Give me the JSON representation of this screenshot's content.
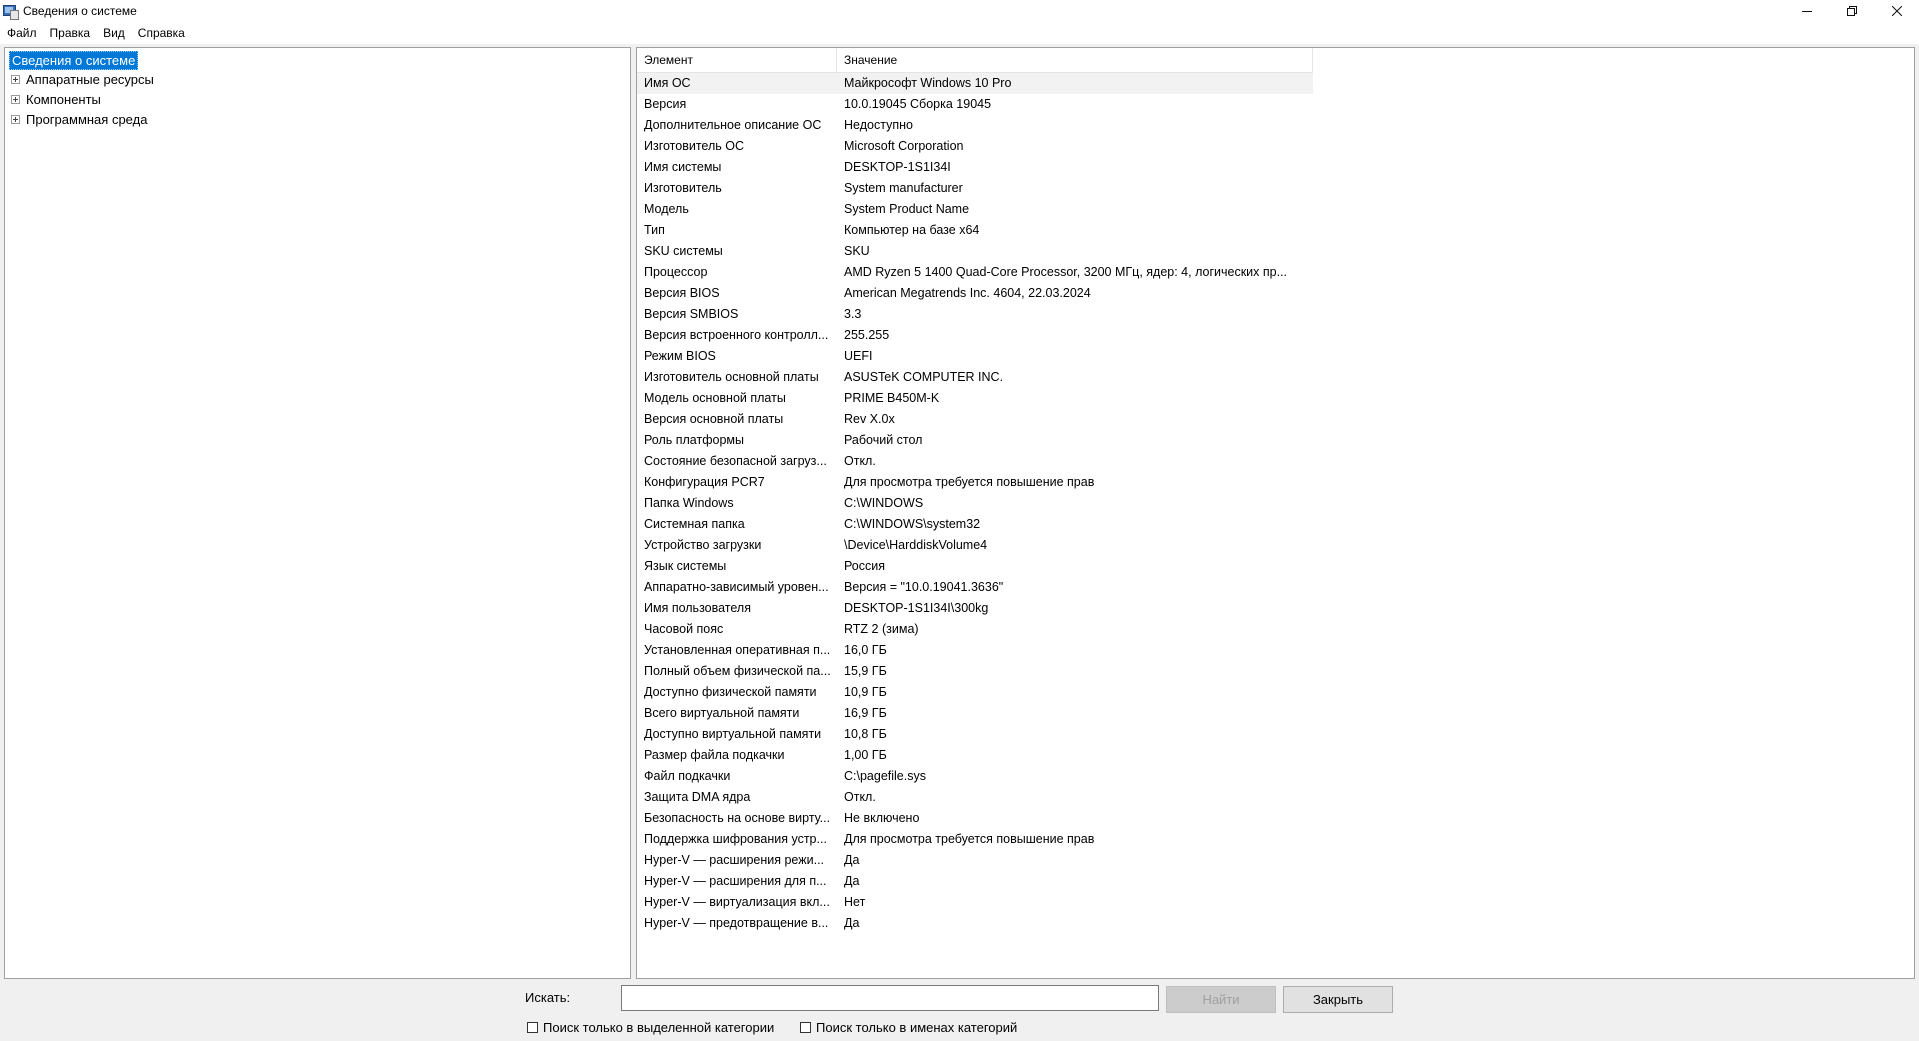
{
  "window": {
    "title": "Сведения о системе"
  },
  "menu": [
    "Файл",
    "Правка",
    "Вид",
    "Справка"
  ],
  "tree": {
    "root": "Сведения о системе",
    "children": [
      "Аппаратные ресурсы",
      "Компоненты",
      "Программная среда"
    ]
  },
  "list": {
    "columns": [
      "Элемент",
      "Значение"
    ],
    "rows": [
      [
        "Имя ОС",
        "Майкрософт Windows 10 Pro"
      ],
      [
        "Версия",
        "10.0.19045 Сборка 19045"
      ],
      [
        "Дополнительное описание ОС",
        "Недоступно"
      ],
      [
        "Изготовитель ОС",
        "Microsoft Corporation"
      ],
      [
        "Имя системы",
        "DESKTOP-1S1I34I"
      ],
      [
        "Изготовитель",
        "System manufacturer"
      ],
      [
        "Модель",
        "System Product Name"
      ],
      [
        "Тип",
        "Компьютер на базе x64"
      ],
      [
        "SKU системы",
        "SKU"
      ],
      [
        "Процессор",
        "AMD Ryzen 5 1400 Quad-Core Processor, 3200 МГц, ядер: 4, логических пр..."
      ],
      [
        "Версия BIOS",
        "American Megatrends Inc. 4604, 22.03.2024"
      ],
      [
        "Версия SMBIOS",
        "3.3"
      ],
      [
        "Версия встроенного контролл...",
        "255.255"
      ],
      [
        "Режим BIOS",
        "UEFI"
      ],
      [
        "Изготовитель основной платы",
        "ASUSTeK COMPUTER INC."
      ],
      [
        "Модель основной платы",
        "PRIME B450M-K"
      ],
      [
        "Версия основной платы",
        "Rev X.0x"
      ],
      [
        "Роль платформы",
        "Рабочий стол"
      ],
      [
        "Состояние безопасной загруз...",
        "Откл."
      ],
      [
        "Конфигурация PCR7",
        "Для просмотра требуется повышение прав"
      ],
      [
        "Папка Windows",
        "C:\\WINDOWS"
      ],
      [
        "Системная папка",
        "C:\\WINDOWS\\system32"
      ],
      [
        "Устройство загрузки",
        "\\Device\\HarddiskVolume4"
      ],
      [
        "Язык системы",
        "Россия"
      ],
      [
        "Аппаратно-зависимый уровен...",
        "Версия = \"10.0.19041.3636\""
      ],
      [
        "Имя пользователя",
        "DESKTOP-1S1I34I\\300kg"
      ],
      [
        "Часовой пояс",
        "RTZ 2 (зима)"
      ],
      [
        "Установленная оперативная п...",
        "16,0 ГБ"
      ],
      [
        "Полный объем физической па...",
        "15,9 ГБ"
      ],
      [
        "Доступно физической памяти",
        "10,9 ГБ"
      ],
      [
        "Всего виртуальной памяти",
        "16,9 ГБ"
      ],
      [
        "Доступно виртуальной памяти",
        "10,8 ГБ"
      ],
      [
        "Размер файла подкачки",
        "1,00 ГБ"
      ],
      [
        "Файл подкачки",
        "C:\\pagefile.sys"
      ],
      [
        "Защита DMA ядра",
        "Откл."
      ],
      [
        "Безопасность на основе вирту...",
        "Не включено"
      ],
      [
        "Поддержка шифрования устр...",
        "Для просмотра требуется повышение прав"
      ],
      [
        "Hyper-V — расширения режи...",
        "Да"
      ],
      [
        "Hyper-V — расширения для п...",
        "Да"
      ],
      [
        "Hyper-V — виртуализация вкл...",
        "Нет"
      ],
      [
        "Hyper-V — предотвращение в...",
        "Да"
      ]
    ]
  },
  "search": {
    "label": "Искать:",
    "value": "",
    "find_button": "Найти",
    "close_button": "Закрыть",
    "checkbox_selected_category": "Поиск только в выделенной категории",
    "checkbox_category_names": "Поиск только в именах категорий"
  },
  "colors": {
    "selection": "#0078d7"
  }
}
